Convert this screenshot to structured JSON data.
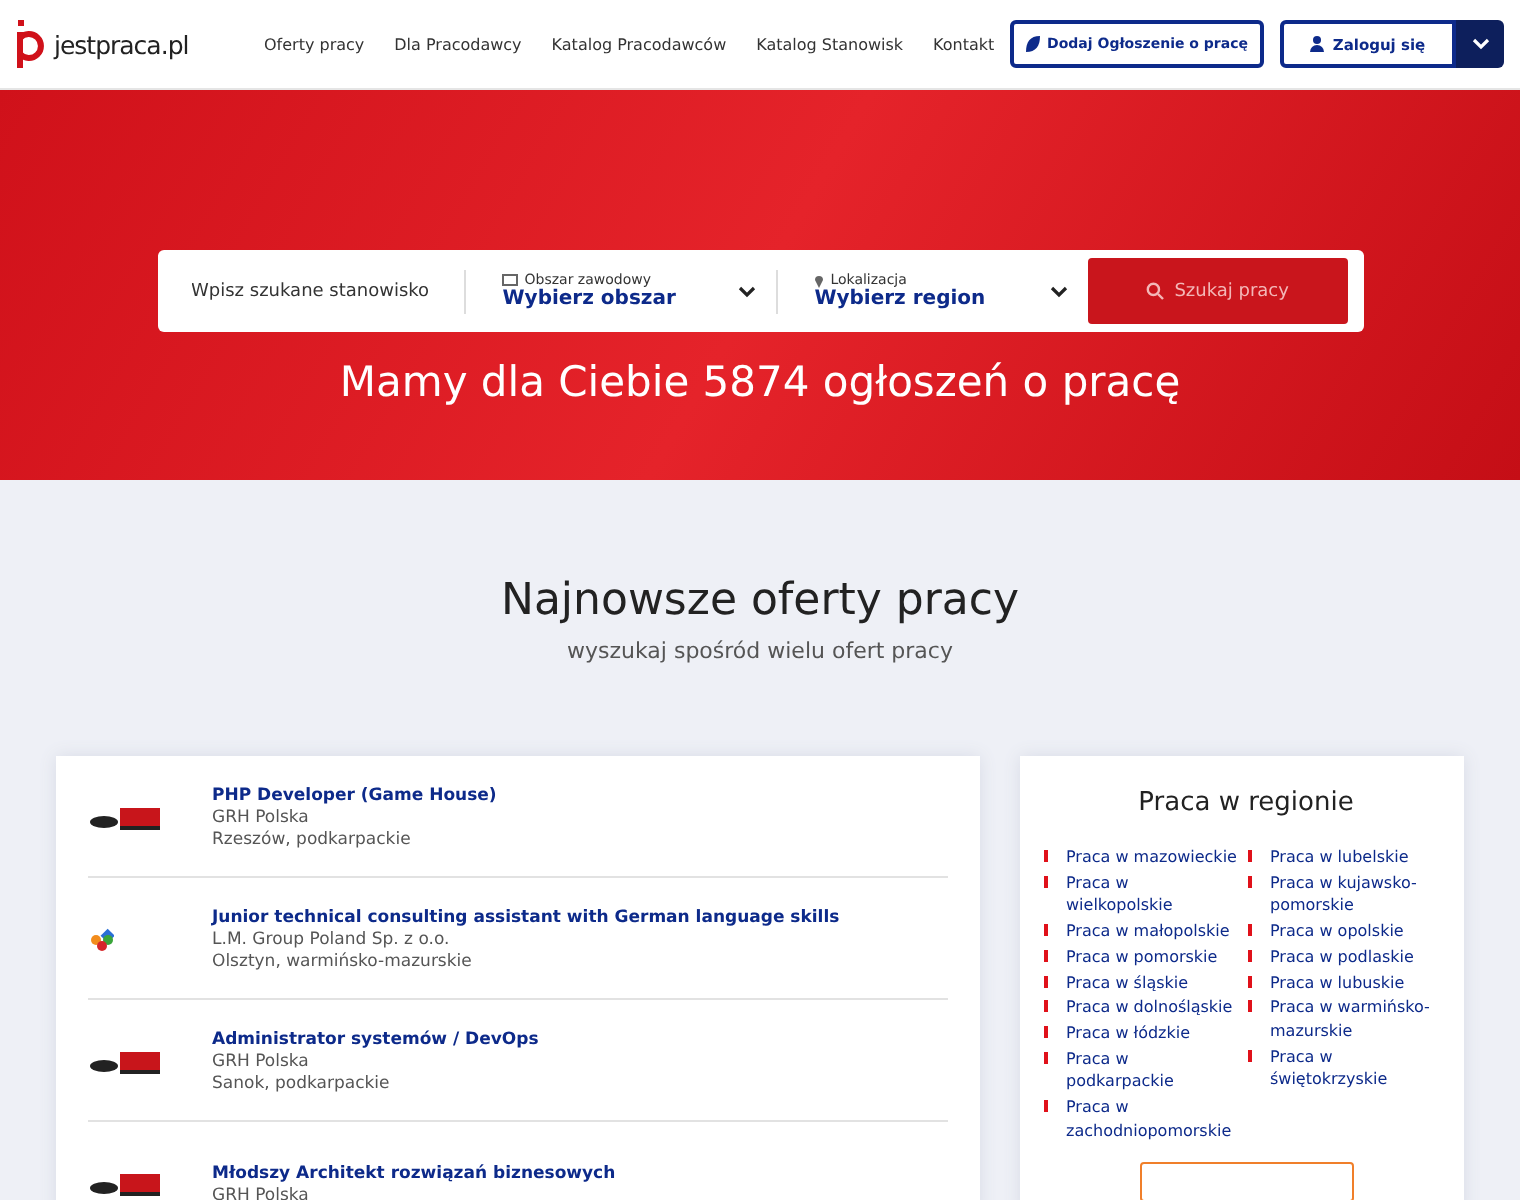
{
  "header": {
    "logo": "jestpraca.pl",
    "nav": [
      "Oferty pracy",
      "Dla Pracodawcy",
      "Katalog Pracodawców",
      "Katalog Stanowisk",
      "Kontakt"
    ],
    "add_button": "Dodaj Ogłoszenie o pracę",
    "login_button": "Zaloguj się"
  },
  "search": {
    "placeholder": "Wpisz szukane stanowisko",
    "area": {
      "label": "Obszar zawodowy",
      "value": "Wybierz obszar"
    },
    "region": {
      "label": "Lokalizacja",
      "value": "Wybierz region"
    },
    "button": "Szukaj pracy"
  },
  "headline": "Mamy dla Ciebie 5874 ogłoszeń o pracę",
  "section": {
    "title": "Najnowsze oferty pracy",
    "subtitle": "wyszukaj spośród wielu ofert pracy"
  },
  "jobs": [
    {
      "kind": "grh",
      "title": "PHP Developer (Game House)",
      "company": "GRH Polska",
      "location": "Rzeszów, podkarpackie"
    },
    {
      "kind": "tiles",
      "title": "Junior technical consulting assistant with German language skills",
      "company": "L.M. Group Poland Sp. z o.o.",
      "location": "Olsztyn, warmińsko-mazurskie"
    },
    {
      "kind": "grh",
      "title": "Administrator systemów / DevOps",
      "company": "GRH Polska",
      "location": "Sanok, podkarpackie"
    },
    {
      "kind": "grh",
      "title": "Młodszy Architekt rozwiązań biznesowych",
      "company": "GRH Polska"
    }
  ],
  "regions": {
    "title": "Praca w regionie",
    "columns": [
      [
        "Praca w mazowieckie",
        "Praca w wielkopolskie",
        "Praca w małopolskie",
        "Praca w pomorskie",
        "Praca w śląskie",
        "Praca w dolnośląskie",
        "Praca w łódzkie",
        "Praca w podkarpackie",
        "Praca w zachodniopomorskie"
      ],
      [
        "Praca w lubelskie",
        "Praca w kujawsko-pomorskie",
        "Praca w opolskie",
        "Praca w podlaskie",
        "Praca w lubuskie",
        "Praca w warmińsko-mazurskie",
        "Praca w świętokrzyskie"
      ]
    ]
  }
}
